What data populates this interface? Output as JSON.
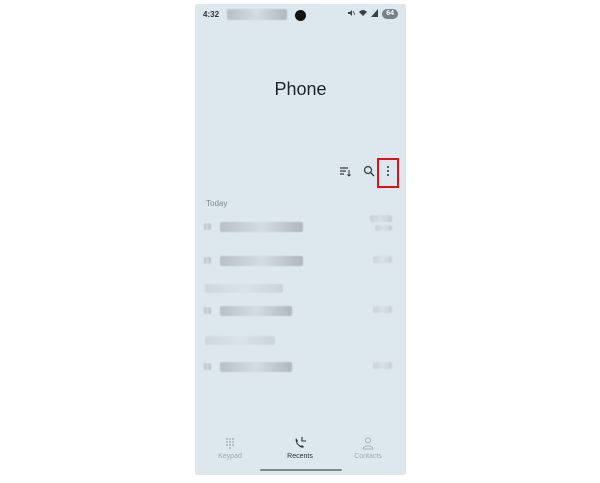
{
  "status_bar": {
    "time": "4:32",
    "battery": "64",
    "icons": [
      "mute-icon",
      "wifi-icon",
      "signal-icon",
      "battery-icon"
    ]
  },
  "header": {
    "title": "Phone"
  },
  "toolbar": {
    "icons": [
      "sort-filter-icon",
      "search-icon",
      "more-options-icon"
    ],
    "highlight_color": "#e2101b"
  },
  "recents": {
    "section_today": "Today"
  },
  "bottom_nav": {
    "items": [
      {
        "label": "Keypad",
        "icon": "keypad-icon"
      },
      {
        "label": "Recents",
        "icon": "recents-icon"
      },
      {
        "label": "Contacts",
        "icon": "contacts-icon"
      }
    ],
    "active": "Recents"
  },
  "colors": {
    "screen_background": "#dde8ee",
    "text_primary": "#1d232b"
  }
}
